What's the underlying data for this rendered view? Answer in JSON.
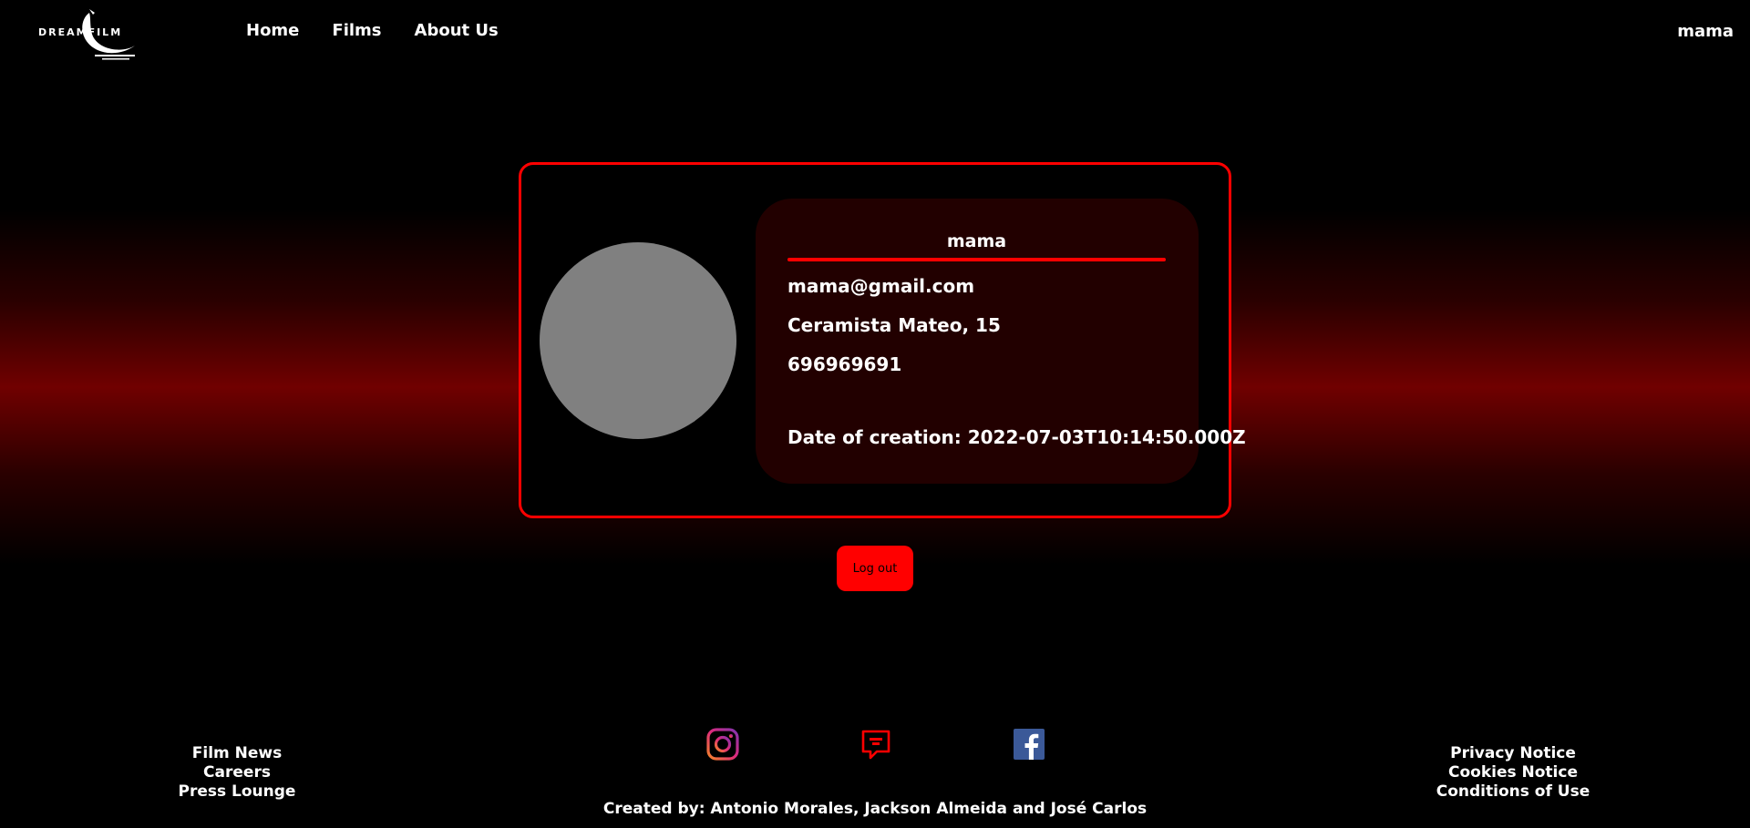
{
  "brand": {
    "logo_text": "DREAMFILM"
  },
  "nav": {
    "items": [
      {
        "label": "Home"
      },
      {
        "label": "Films"
      },
      {
        "label": "About Us"
      }
    ],
    "user": "mama"
  },
  "profile": {
    "username": "mama",
    "email": "mama@gmail.com",
    "address": "Ceramista Mateo, 15",
    "phone": "696969691",
    "created": "Date of creation: 2022-07-03T10:14:50.000Z"
  },
  "actions": {
    "logout_label": "Log out"
  },
  "footer": {
    "left_links": [
      "Film News",
      "Careers",
      "Press Lounge"
    ],
    "right_links": [
      "Privacy Notice",
      "Cookies Notice",
      "Conditions of Use"
    ],
    "social_icons": [
      "instagram-icon",
      "chat-icon",
      "facebook-icon"
    ],
    "credits": "Created by: Antonio Morales, Jackson Almeida and José Carlos"
  },
  "colors": {
    "accent": "#ff0000",
    "panel": "#220000",
    "avatar": "#808080",
    "facebook": "#3b5998"
  }
}
